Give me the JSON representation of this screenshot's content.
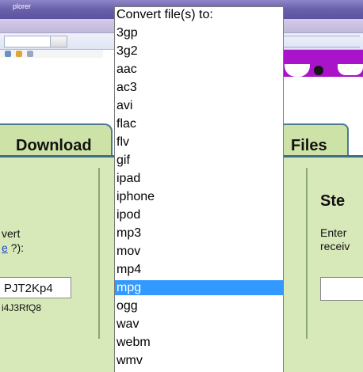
{
  "window": {
    "title_fragment": "plorer"
  },
  "page": {
    "download_tab_label": "Download",
    "files_tab_label": "Files",
    "step_heading": "Ste",
    "enter_text_line1": "Enter",
    "enter_text_line2": "receiv",
    "convert_text": "vert",
    "help_link_label": "e",
    "help_suffix": " ?):",
    "code_value": "PJT2Kp4",
    "code_sub": "i4J3RfQ8"
  },
  "dropdown": {
    "header": "Convert file(s) to:",
    "selected": "mpg",
    "options": [
      "3gp",
      "3g2",
      "aac",
      "ac3",
      "avi",
      "flac",
      "flv",
      "gif",
      "ipad",
      "iphone",
      "ipod",
      "mp3",
      "mov",
      "mp4",
      "mpg",
      "ogg",
      "wav",
      "webm",
      "wmv"
    ]
  },
  "colors": {
    "selection": "#3399ff",
    "panel_green": "#d8e9b9",
    "tab_green": "#cde2a6",
    "banner_purple": "#a913c9",
    "link_blue": "#1a46c8"
  }
}
